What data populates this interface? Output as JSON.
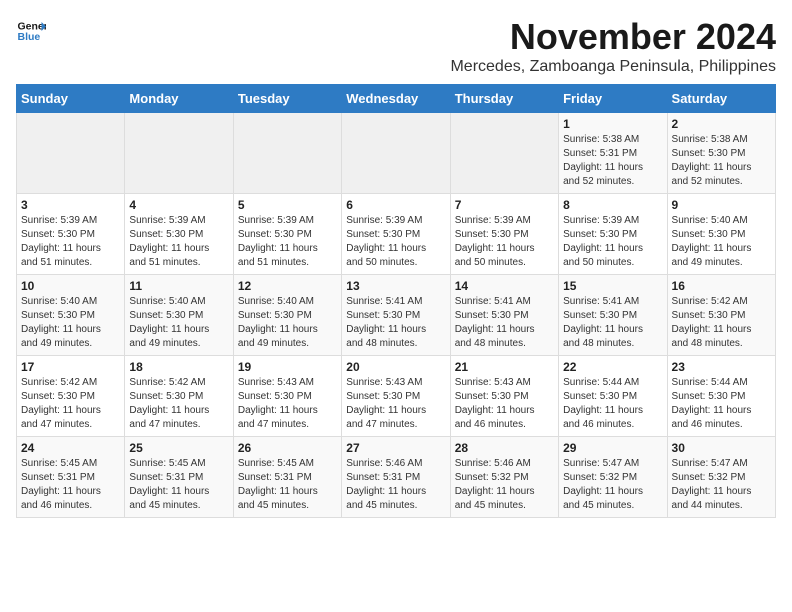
{
  "logo": {
    "line1": "General",
    "line2": "Blue"
  },
  "title": "November 2024",
  "location": "Mercedes, Zamboanga Peninsula, Philippines",
  "weekdays": [
    "Sunday",
    "Monday",
    "Tuesday",
    "Wednesday",
    "Thursday",
    "Friday",
    "Saturday"
  ],
  "weeks": [
    [
      {
        "day": "",
        "info": ""
      },
      {
        "day": "",
        "info": ""
      },
      {
        "day": "",
        "info": ""
      },
      {
        "day": "",
        "info": ""
      },
      {
        "day": "",
        "info": ""
      },
      {
        "day": "1",
        "info": "Sunrise: 5:38 AM\nSunset: 5:31 PM\nDaylight: 11 hours\nand 52 minutes."
      },
      {
        "day": "2",
        "info": "Sunrise: 5:38 AM\nSunset: 5:30 PM\nDaylight: 11 hours\nand 52 minutes."
      }
    ],
    [
      {
        "day": "3",
        "info": "Sunrise: 5:39 AM\nSunset: 5:30 PM\nDaylight: 11 hours\nand 51 minutes."
      },
      {
        "day": "4",
        "info": "Sunrise: 5:39 AM\nSunset: 5:30 PM\nDaylight: 11 hours\nand 51 minutes."
      },
      {
        "day": "5",
        "info": "Sunrise: 5:39 AM\nSunset: 5:30 PM\nDaylight: 11 hours\nand 51 minutes."
      },
      {
        "day": "6",
        "info": "Sunrise: 5:39 AM\nSunset: 5:30 PM\nDaylight: 11 hours\nand 50 minutes."
      },
      {
        "day": "7",
        "info": "Sunrise: 5:39 AM\nSunset: 5:30 PM\nDaylight: 11 hours\nand 50 minutes."
      },
      {
        "day": "8",
        "info": "Sunrise: 5:39 AM\nSunset: 5:30 PM\nDaylight: 11 hours\nand 50 minutes."
      },
      {
        "day": "9",
        "info": "Sunrise: 5:40 AM\nSunset: 5:30 PM\nDaylight: 11 hours\nand 49 minutes."
      }
    ],
    [
      {
        "day": "10",
        "info": "Sunrise: 5:40 AM\nSunset: 5:30 PM\nDaylight: 11 hours\nand 49 minutes."
      },
      {
        "day": "11",
        "info": "Sunrise: 5:40 AM\nSunset: 5:30 PM\nDaylight: 11 hours\nand 49 minutes."
      },
      {
        "day": "12",
        "info": "Sunrise: 5:40 AM\nSunset: 5:30 PM\nDaylight: 11 hours\nand 49 minutes."
      },
      {
        "day": "13",
        "info": "Sunrise: 5:41 AM\nSunset: 5:30 PM\nDaylight: 11 hours\nand 48 minutes."
      },
      {
        "day": "14",
        "info": "Sunrise: 5:41 AM\nSunset: 5:30 PM\nDaylight: 11 hours\nand 48 minutes."
      },
      {
        "day": "15",
        "info": "Sunrise: 5:41 AM\nSunset: 5:30 PM\nDaylight: 11 hours\nand 48 minutes."
      },
      {
        "day": "16",
        "info": "Sunrise: 5:42 AM\nSunset: 5:30 PM\nDaylight: 11 hours\nand 48 minutes."
      }
    ],
    [
      {
        "day": "17",
        "info": "Sunrise: 5:42 AM\nSunset: 5:30 PM\nDaylight: 11 hours\nand 47 minutes."
      },
      {
        "day": "18",
        "info": "Sunrise: 5:42 AM\nSunset: 5:30 PM\nDaylight: 11 hours\nand 47 minutes."
      },
      {
        "day": "19",
        "info": "Sunrise: 5:43 AM\nSunset: 5:30 PM\nDaylight: 11 hours\nand 47 minutes."
      },
      {
        "day": "20",
        "info": "Sunrise: 5:43 AM\nSunset: 5:30 PM\nDaylight: 11 hours\nand 47 minutes."
      },
      {
        "day": "21",
        "info": "Sunrise: 5:43 AM\nSunset: 5:30 PM\nDaylight: 11 hours\nand 46 minutes."
      },
      {
        "day": "22",
        "info": "Sunrise: 5:44 AM\nSunset: 5:30 PM\nDaylight: 11 hours\nand 46 minutes."
      },
      {
        "day": "23",
        "info": "Sunrise: 5:44 AM\nSunset: 5:30 PM\nDaylight: 11 hours\nand 46 minutes."
      }
    ],
    [
      {
        "day": "24",
        "info": "Sunrise: 5:45 AM\nSunset: 5:31 PM\nDaylight: 11 hours\nand 46 minutes."
      },
      {
        "day": "25",
        "info": "Sunrise: 5:45 AM\nSunset: 5:31 PM\nDaylight: 11 hours\nand 45 minutes."
      },
      {
        "day": "26",
        "info": "Sunrise: 5:45 AM\nSunset: 5:31 PM\nDaylight: 11 hours\nand 45 minutes."
      },
      {
        "day": "27",
        "info": "Sunrise: 5:46 AM\nSunset: 5:31 PM\nDaylight: 11 hours\nand 45 minutes."
      },
      {
        "day": "28",
        "info": "Sunrise: 5:46 AM\nSunset: 5:32 PM\nDaylight: 11 hours\nand 45 minutes."
      },
      {
        "day": "29",
        "info": "Sunrise: 5:47 AM\nSunset: 5:32 PM\nDaylight: 11 hours\nand 45 minutes."
      },
      {
        "day": "30",
        "info": "Sunrise: 5:47 AM\nSunset: 5:32 PM\nDaylight: 11 hours\nand 44 minutes."
      }
    ]
  ]
}
